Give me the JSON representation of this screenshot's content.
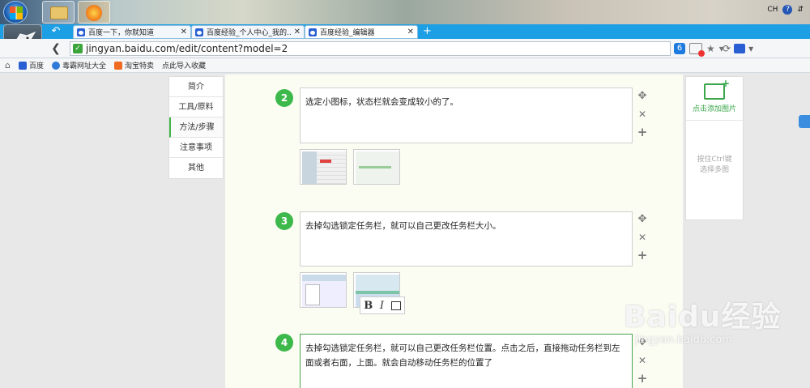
{
  "taskbar": {
    "tray": {
      "lang": "CH",
      "help": "?"
    }
  },
  "browser": {
    "back_label": "↶",
    "tabs": [
      {
        "title": "百度一下，你就知道"
      },
      {
        "title": "百度经验_个人中心_我的..."
      },
      {
        "title": "百度经验_编辑器"
      }
    ],
    "new_tab": "+",
    "url": "jingyan.baidu.com/edit/content?model=2",
    "bookmarks": [
      {
        "label": "百度",
        "color": "#2a5fd4"
      },
      {
        "label": "毒霸网址大全",
        "color": "#2f7ad8"
      },
      {
        "label": "淘宝特卖",
        "color": "#f06a22"
      },
      {
        "label": "点此导入收藏",
        "color": ""
      }
    ]
  },
  "sidebar": {
    "items": [
      {
        "label": "简介",
        "active": false
      },
      {
        "label": "工具/原料",
        "active": false
      },
      {
        "label": "方法/步骤",
        "active": true
      },
      {
        "label": "注意事项",
        "active": false
      },
      {
        "label": "其他",
        "active": false
      }
    ]
  },
  "steps": [
    {
      "num": "2",
      "text": "选定小图标，状态栏就会变成较小的了。"
    },
    {
      "num": "3",
      "text": "去掉勾选锁定任务栏，就可以自己更改任务栏大小。"
    },
    {
      "num": "4",
      "text": "去掉勾选锁定任务栏，就可以自己更改任务栏位置。点击之后，直接拖动任务栏到左面或者右面，上面。就会自动移动任务栏的位置了"
    }
  ],
  "editor_toolbar": {
    "bold": "B",
    "italic": "I"
  },
  "right_panel": {
    "add_image": "点击添加图片",
    "multi_select": "按住Ctrl键\n选择多图"
  },
  "watermark": {
    "brand": "Baidu经验",
    "site": "jingyan.baidu.com"
  },
  "colors": {
    "accent_green": "#3db84a",
    "tab_blue": "#1c9fe4"
  }
}
